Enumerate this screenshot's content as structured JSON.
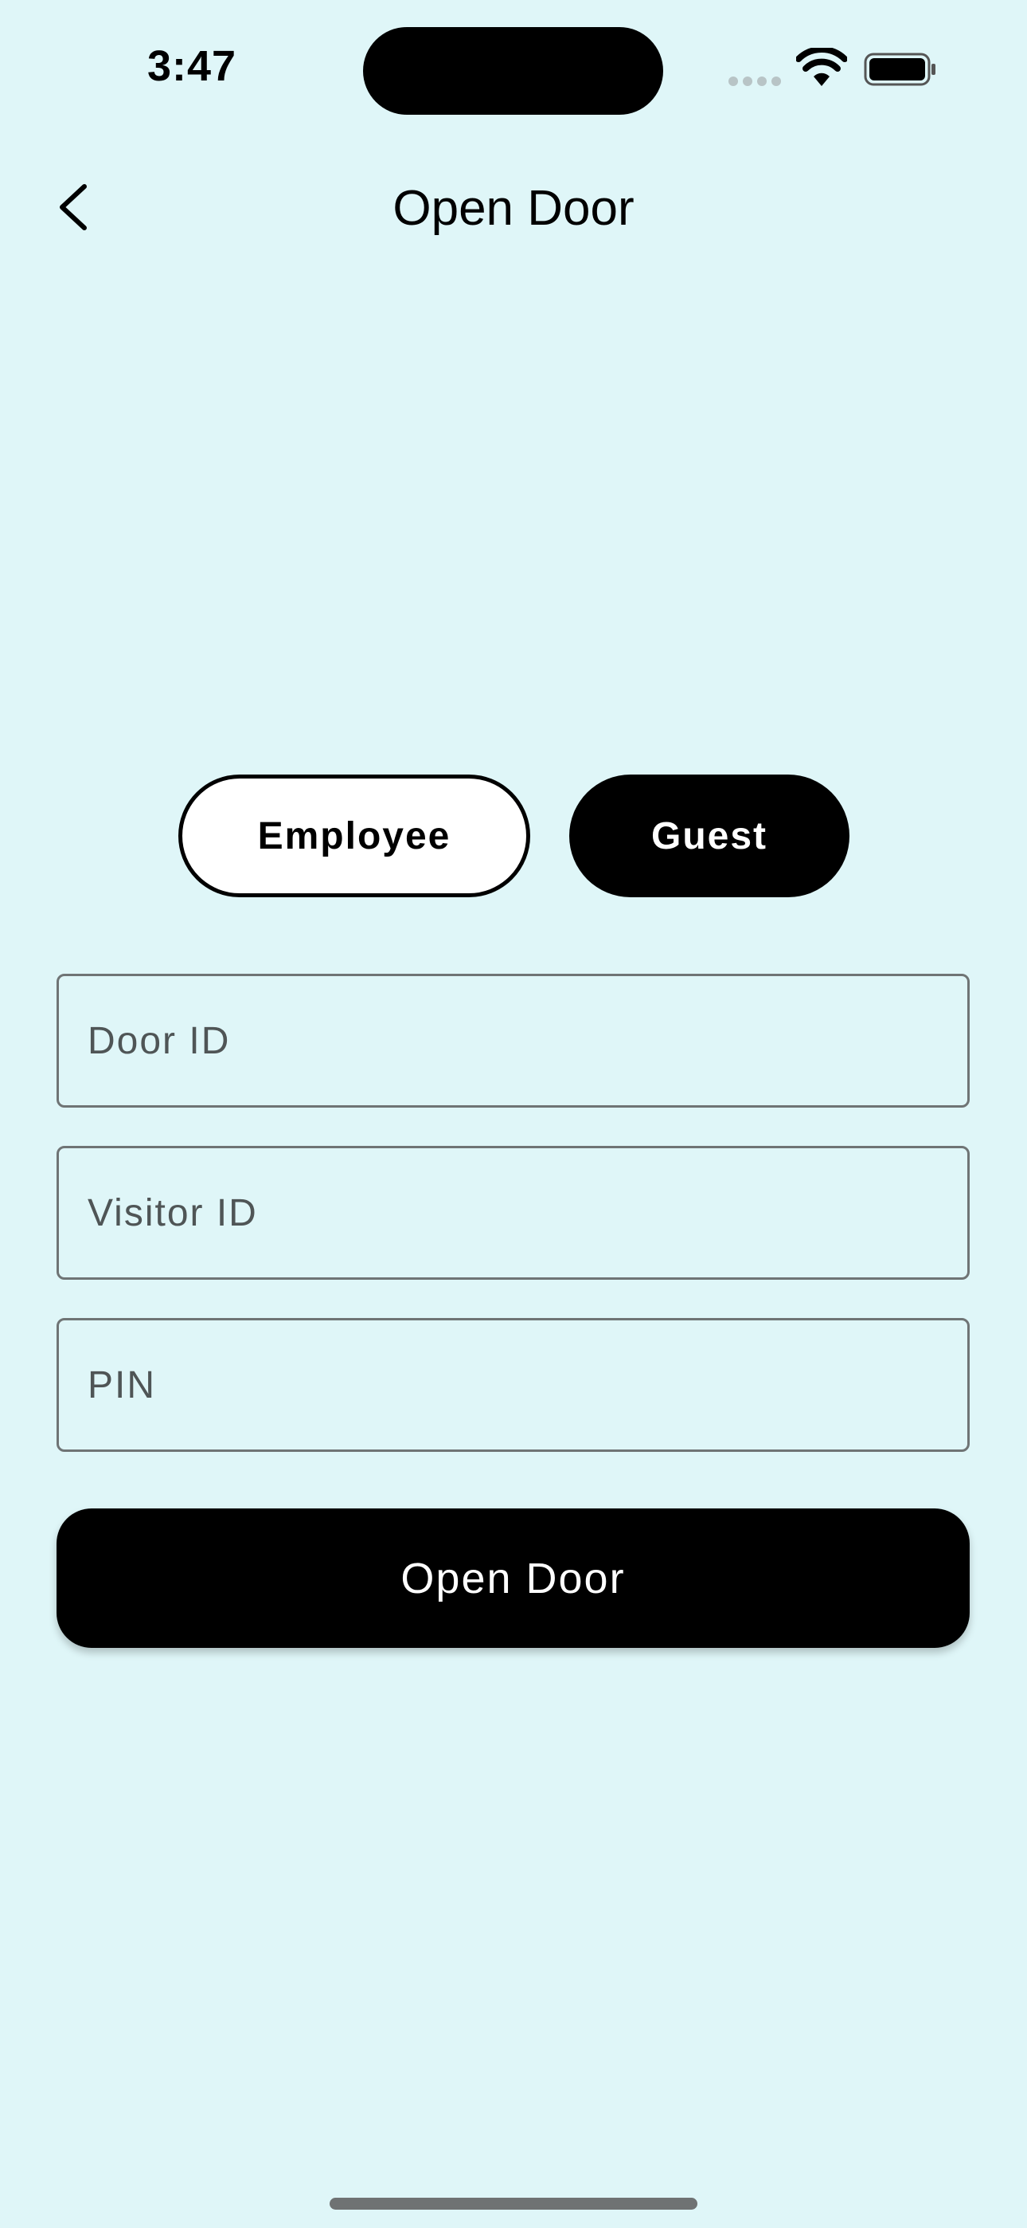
{
  "status_bar": {
    "time": "3:47",
    "icons": [
      "cellular-signal-icon",
      "wifi-icon",
      "battery-icon"
    ]
  },
  "nav": {
    "back_icon": "chevron-left-icon",
    "title": "Open Door"
  },
  "mode_toggle": {
    "employee_label": "Employee",
    "guest_label": "Guest",
    "selected": "Guest"
  },
  "form": {
    "door_id": {
      "placeholder": "Door ID",
      "value": ""
    },
    "visitor_id": {
      "placeholder": "Visitor ID",
      "value": ""
    },
    "pin": {
      "placeholder": "PIN",
      "value": ""
    },
    "submit_label": "Open Door"
  },
  "colors": {
    "background": "#dff6f8",
    "primary": "#000000",
    "surface": "#ffffff",
    "field_border": "#6f7475",
    "placeholder": "#4f5556"
  }
}
